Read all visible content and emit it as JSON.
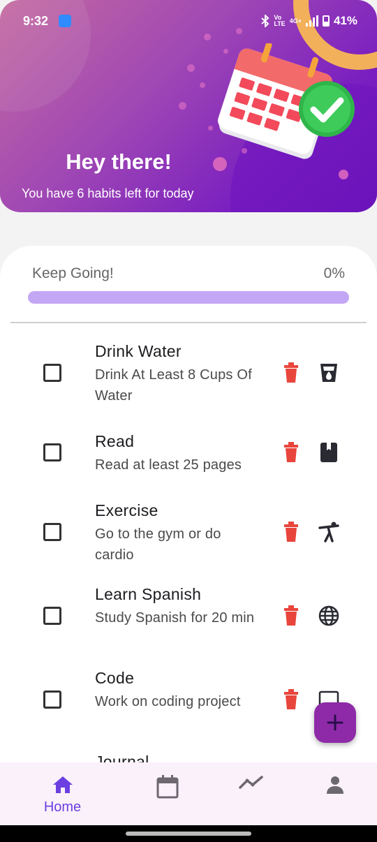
{
  "status": {
    "time": "9:32",
    "battery": "41%",
    "net_top": "Vo",
    "net_bottom": "LTE",
    "net_speed": "4G+"
  },
  "header": {
    "greeting": "Hey there!",
    "subtitle": "You have 6 habits left for today"
  },
  "progress": {
    "label": "Keep Going!",
    "percent_text": "0%",
    "value": 0
  },
  "habits": [
    {
      "title": "Drink Water",
      "desc": "Drink At Least 8 Cups Of Water",
      "icon": "cup-icon",
      "checked": false
    },
    {
      "title": "Read",
      "desc": "Read at least 25 pages",
      "icon": "book-icon",
      "checked": false
    },
    {
      "title": "Exercise",
      "desc": "Go to the gym or do cardio",
      "icon": "exercise-icon",
      "checked": false
    },
    {
      "title": "Learn Spanish",
      "desc": "Study Spanish for 20 min",
      "icon": "globe-icon",
      "checked": false
    },
    {
      "title": "Code",
      "desc": "Work on coding project",
      "icon": "laptop-icon",
      "checked": false
    },
    {
      "title": "Journal",
      "desc": "",
      "icon": "",
      "checked": false
    }
  ],
  "nav": {
    "items": [
      {
        "label": "Home",
        "icon": "home-icon",
        "active": true
      },
      {
        "label": "",
        "icon": "calendar-icon",
        "active": false
      },
      {
        "label": "",
        "icon": "trend-icon",
        "active": false
      },
      {
        "label": "",
        "icon": "profile-icon",
        "active": false
      }
    ]
  },
  "colors": {
    "accent": "#6b3fe0",
    "fab": "#8e2aa8",
    "delete": "#e8453c",
    "progress_track": "#c3a7f4"
  }
}
